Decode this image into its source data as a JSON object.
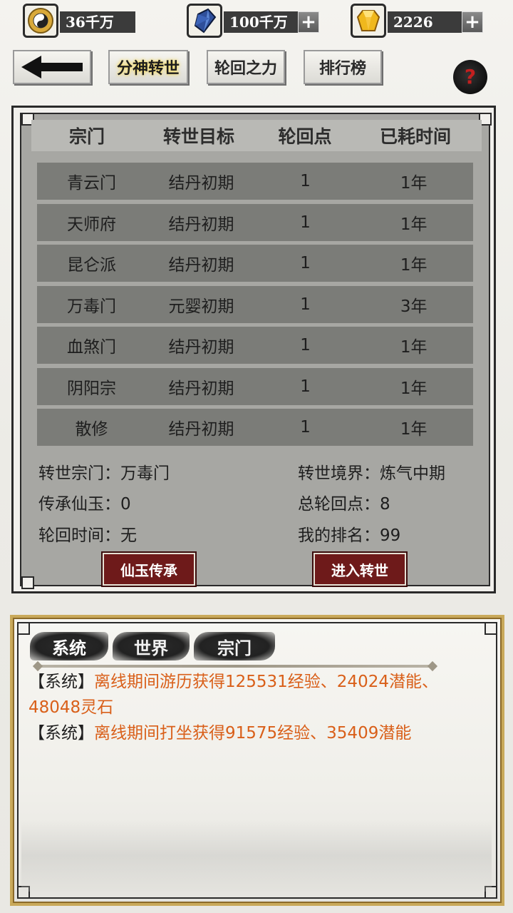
{
  "currencies": [
    {
      "icon": "yin-yang-coin-icon",
      "value": "36千万",
      "has_plus": false
    },
    {
      "icon": "blue-crystal-icon",
      "value": "100千万",
      "has_plus": true
    },
    {
      "icon": "gold-gem-icon",
      "value": "2226",
      "has_plus": true
    }
  ],
  "nav": {
    "back_icon": "left-arrow-icon",
    "tabs": [
      "分神转世",
      "轮回之力",
      "排行榜"
    ],
    "active_tab": "分神转世",
    "help_label": "?"
  },
  "table": {
    "headers": [
      "宗门",
      "转世目标",
      "轮回点",
      "已耗时间"
    ],
    "rows": [
      [
        "青云门",
        "结丹初期",
        "1",
        "1年"
      ],
      [
        "天师府",
        "结丹初期",
        "1",
        "1年"
      ],
      [
        "昆仑派",
        "结丹初期",
        "1",
        "1年"
      ],
      [
        "万毒门",
        "元婴初期",
        "1",
        "3年"
      ],
      [
        "血煞门",
        "结丹初期",
        "1",
        "1年"
      ],
      [
        "阴阳宗",
        "结丹初期",
        "1",
        "1年"
      ],
      [
        "散修",
        "结丹初期",
        "1",
        "1年"
      ]
    ]
  },
  "info": {
    "left": [
      "转世宗门：万毒门",
      "传承仙玉：0",
      "轮回时间：无"
    ],
    "right": [
      "转世境界：炼气中期",
      "总轮回点：8",
      "我的排名：99"
    ]
  },
  "buttons": {
    "inherit": "仙玉传承",
    "enter": "进入转世"
  },
  "chat": {
    "tabs": [
      "系统",
      "世界",
      "宗门"
    ],
    "active_tab": "系统",
    "messages": [
      {
        "tag": "【系统】",
        "text": "离线期间游历获得125531经验、24024潜能、48048灵石"
      },
      {
        "tag": "【系统】",
        "text": "离线期间打坐获得91575经验、35409潜能"
      }
    ]
  },
  "colors": {
    "panel_bg": "#a7a7a3",
    "row_bg": "#7b7c78",
    "message_highlight": "#d95f19",
    "button_red": "#6e1a1a",
    "chat_border_gold": "#c9a95a"
  }
}
